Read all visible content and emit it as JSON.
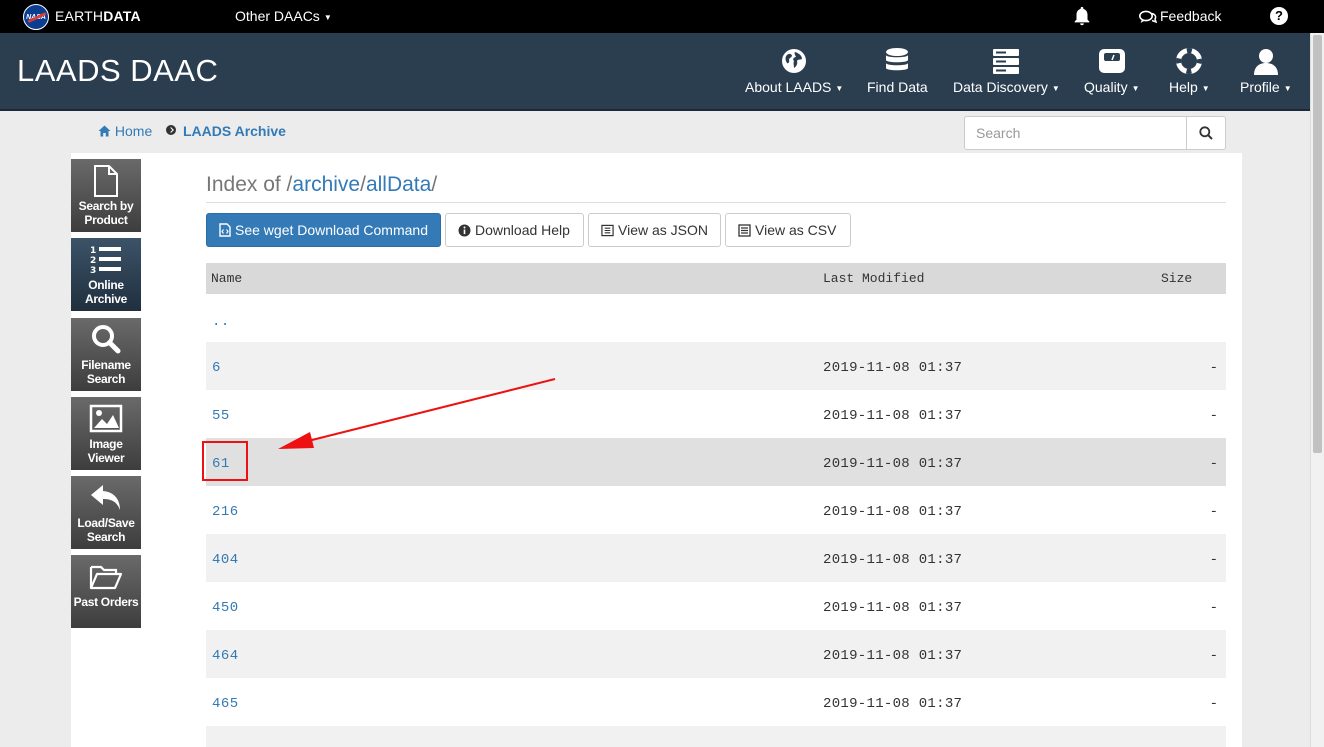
{
  "topbar": {
    "brand_prefix": "EARTH",
    "brand_suffix": "DATA",
    "other_daacs": "Other DAACs",
    "feedback": "Feedback",
    "help": "?"
  },
  "header": {
    "title": "LAADS DAAC",
    "nav": [
      {
        "label": "About LAADS",
        "icon": "globe-icon",
        "dropdown": true
      },
      {
        "label": "Find Data",
        "icon": "database-icon",
        "dropdown": false
      },
      {
        "label": "Data Discovery",
        "icon": "server-icon",
        "dropdown": true
      },
      {
        "label": "Quality",
        "icon": "scale-icon",
        "dropdown": true
      },
      {
        "label": "Help",
        "icon": "life-ring-icon",
        "dropdown": true
      },
      {
        "label": "Profile",
        "icon": "user-icon",
        "dropdown": true
      }
    ]
  },
  "breadcrumb": {
    "home": "Home",
    "current": "LAADS Archive"
  },
  "search": {
    "placeholder": "Search"
  },
  "tools": [
    {
      "line1": "Search by",
      "line2": "Product",
      "icon": "file-icon"
    },
    {
      "line1": "Online",
      "line2": "Archive",
      "icon": "numbered-list-icon",
      "active": true
    },
    {
      "line1": "Filename",
      "line2": "Search",
      "icon": "search-icon"
    },
    {
      "line1": "Image",
      "line2": "Viewer",
      "icon": "image-icon"
    },
    {
      "line1": "Load/Save",
      "line2": "Search",
      "icon": "reply-icon"
    },
    {
      "line1": "Past Orders",
      "line2": "",
      "icon": "folder-open-icon"
    }
  ],
  "index": {
    "prefix": "Index of /",
    "seg1": "archive",
    "slash": "/",
    "seg2": "allData",
    "trail": "/"
  },
  "buttons": {
    "wget": "See wget Download Command",
    "download_help": "Download Help",
    "json": "View as JSON",
    "csv": "View as CSV"
  },
  "table": {
    "headers": [
      "Name",
      "Last Modified",
      "Size"
    ],
    "rows": [
      {
        "name": "..",
        "modified": "",
        "size": ""
      },
      {
        "name": "6",
        "modified": "2019-11-08 01:37",
        "size": "-"
      },
      {
        "name": "55",
        "modified": "2019-11-08 01:37",
        "size": "-"
      },
      {
        "name": "61",
        "modified": "2019-11-08 01:37",
        "size": "-"
      },
      {
        "name": "216",
        "modified": "2019-11-08 01:37",
        "size": "-"
      },
      {
        "name": "404",
        "modified": "2019-11-08 01:37",
        "size": "-"
      },
      {
        "name": "450",
        "modified": "2019-11-08 01:37",
        "size": "-"
      },
      {
        "name": "464",
        "modified": "2019-11-08 01:37",
        "size": "-"
      },
      {
        "name": "465",
        "modified": "2019-11-08 01:37",
        "size": "-"
      }
    ]
  },
  "colors": {
    "header_bg": "#2b3e50",
    "link": "#337ab7",
    "primary_button": "#337ab7",
    "annotation": "#e11111"
  }
}
